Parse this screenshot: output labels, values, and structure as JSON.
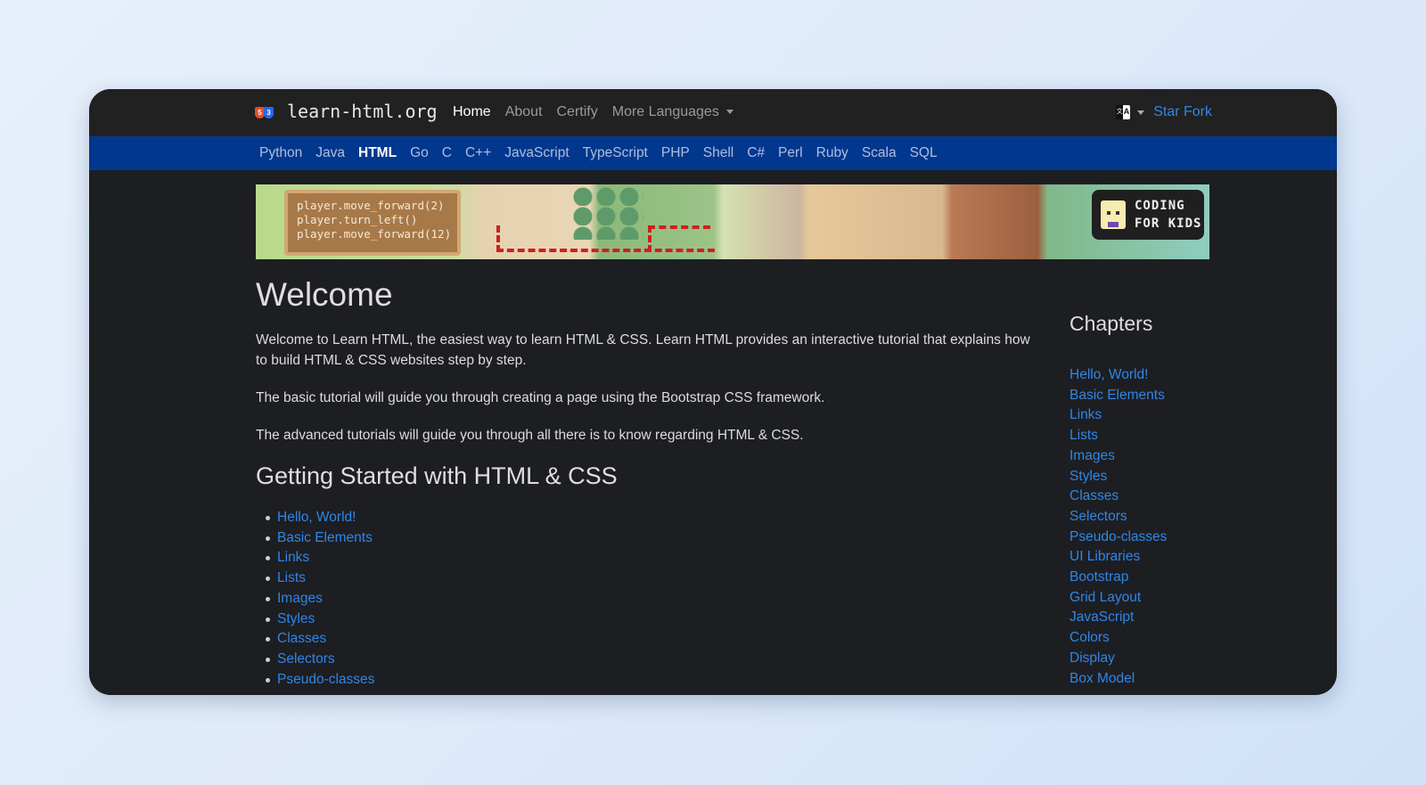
{
  "colors": {
    "page_bg": "#e2edfb",
    "window_bg": "#1d1e22",
    "topnav_bg": "#212121",
    "langbar_bg": "#02378e",
    "link": "#2f86e6"
  },
  "topnav": {
    "brand": "learn-html.org",
    "brand_icon": "html5-css3-logo-icon",
    "links": [
      {
        "label": "Home",
        "active": true
      },
      {
        "label": "About",
        "active": false
      },
      {
        "label": "Certify",
        "active": false
      },
      {
        "label": "More Languages",
        "active": false,
        "dropdown": true
      }
    ],
    "translate_icon": "translate-icon",
    "star_fork": "Star Fork"
  },
  "langbar": {
    "items": [
      "Python",
      "Java",
      "HTML",
      "Go",
      "C",
      "C++",
      "JavaScript",
      "TypeScript",
      "PHP",
      "Shell",
      "C#",
      "Perl",
      "Ruby",
      "Scala",
      "SQL"
    ],
    "active": "HTML"
  },
  "banner": {
    "code_lines": [
      "player.move_forward(2)",
      "player.turn_left()",
      "player.move_forward(12)"
    ],
    "badge_line1": "CODING",
    "badge_line2": "FOR KIDS"
  },
  "main": {
    "title": "Welcome",
    "paragraphs": [
      "Welcome to Learn HTML, the easiest way to learn HTML & CSS. Learn HTML provides an interactive tutorial that explains how to build HTML & CSS websites step by step.",
      "The basic tutorial will guide you through creating a page using the Bootstrap CSS framework.",
      "The advanced tutorials will guide you through all there is to know regarding HTML & CSS."
    ],
    "getting_started_title": "Getting Started with HTML & CSS",
    "toc": [
      "Hello, World!",
      "Basic Elements",
      "Links",
      "Lists",
      "Images",
      "Styles",
      "Classes",
      "Selectors",
      "Pseudo-classes"
    ]
  },
  "sidebar": {
    "title": "Chapters",
    "chapters": [
      "Hello, World!",
      "Basic Elements",
      "Links",
      "Lists",
      "Images",
      "Styles",
      "Classes",
      "Selectors",
      "Pseudo-classes",
      "UI Libraries",
      "Bootstrap",
      "Grid Layout",
      "JavaScript",
      "Colors",
      "Display",
      "Box Model"
    ]
  }
}
